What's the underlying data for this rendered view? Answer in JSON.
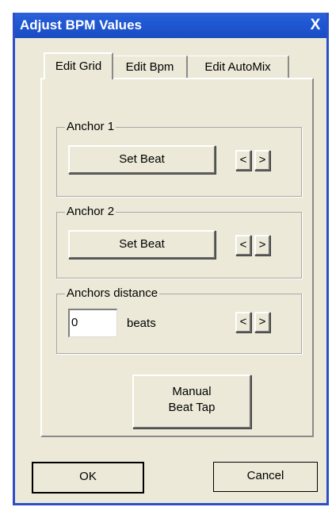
{
  "window": {
    "title": "Adjust BPM Values",
    "close_glyph": "X"
  },
  "tabs": [
    {
      "label": "Edit Grid",
      "active": true
    },
    {
      "label": "Edit Bpm",
      "active": false
    },
    {
      "label": "Edit AutoMix",
      "active": false
    }
  ],
  "anchor1": {
    "label": "Anchor 1",
    "set_beat_label": "Set Beat",
    "prev_label": "<",
    "next_label": ">"
  },
  "anchor2": {
    "label": "Anchor 2",
    "set_beat_label": "Set Beat",
    "prev_label": "<",
    "next_label": ">"
  },
  "anchors_distance": {
    "label": "Anchors distance",
    "value": "0",
    "unit": "beats",
    "prev_label": "<",
    "next_label": ">"
  },
  "manual_tap": {
    "line1": "Manual",
    "line2": "Beat Tap"
  },
  "footer": {
    "ok_label": "OK",
    "cancel_label": "Cancel"
  }
}
